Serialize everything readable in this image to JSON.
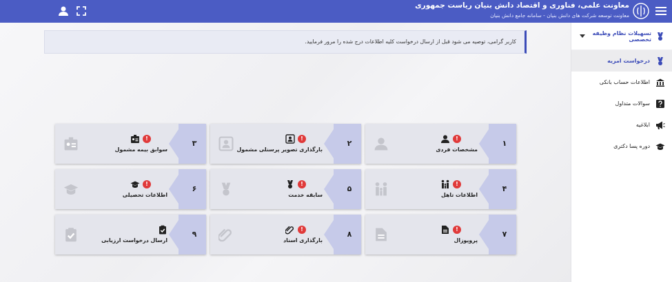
{
  "header": {
    "title": "معاونت علمی، فناوری و اقتصاد دانش بنیان ریاست جمهوری",
    "subtitle": "معاونت توسعه شرکت های دانش بنیان - سامانه جامع دانش بنیان"
  },
  "sidebar": {
    "group_label": "تسهیلات نظام وظیفه تخصصی",
    "items": [
      {
        "label": "درخواست امریه",
        "icon": "medal-icon",
        "active": true
      },
      {
        "label": "اطلاعات حساب بانکی",
        "icon": "bank-icon"
      },
      {
        "label": "سوالات متداول",
        "icon": "question-icon"
      },
      {
        "label": "ابلاغیه",
        "icon": "megaphone-icon"
      },
      {
        "label": "دوره پسا دکتری",
        "icon": "graduation-cap-icon"
      }
    ]
  },
  "notice": {
    "text": "کاربر گرامی، توصیه می شود قبل از ارسال درخواست کلیه اطلاعات درج شده را مرور فرمایید."
  },
  "cards": [
    {
      "num": "۱",
      "label": "مشخصات فردی",
      "icon": "user-icon",
      "alert": true
    },
    {
      "num": "۲",
      "label": "بارگذاری تصویر پرسنلی مشمول",
      "icon": "portrait-icon",
      "alert": true
    },
    {
      "num": "۳",
      "label": "سوابق بیمه مشمول",
      "icon": "id-card-icon",
      "alert": true
    },
    {
      "num": "۴",
      "label": "اطلاعات تاهل",
      "icon": "family-icon",
      "alert": true
    },
    {
      "num": "۵",
      "label": "سابقه خدمت",
      "icon": "medal-icon",
      "alert": true
    },
    {
      "num": "۶",
      "label": "اطلاعات تحصیلی",
      "icon": "graduation-cap-icon",
      "alert": true
    },
    {
      "num": "۷",
      "label": "پروپوزال",
      "icon": "document-icon",
      "alert": true
    },
    {
      "num": "۸",
      "label": "بارگذاری اسناد",
      "icon": "paperclip-icon",
      "alert": true
    },
    {
      "num": "۹",
      "label": "ارسال درخواست ارزیابی",
      "icon": "clipboard-check-icon",
      "alert": false
    }
  ],
  "alert_glyph": "!",
  "colors": {
    "primary": "#4b5cc4",
    "tab": "#c6cae9",
    "alert": "#e03a3a"
  }
}
